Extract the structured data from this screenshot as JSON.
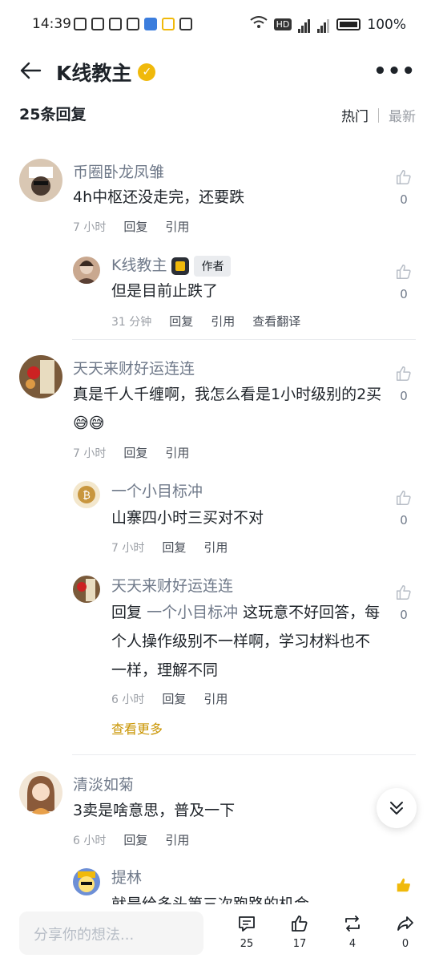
{
  "status_bar": {
    "time": "14:39",
    "battery": "100%",
    "network_badge": "HD"
  },
  "header": {
    "title": "K线教主",
    "back_icon": "back-arrow-icon",
    "more_icon": "more-dots-icon",
    "verified_icon": "verified-check-icon"
  },
  "replies": {
    "count_label": "25条回复",
    "sort_hot": "热门",
    "sort_new": "最新"
  },
  "comments": [
    {
      "name": "币圈卧龙凤雏",
      "text": "4h中枢还没走完，还要跌",
      "time": "7 小时",
      "reply": "回复",
      "quote": "引用",
      "likes": "0"
    },
    {
      "name": "K线教主",
      "badge": "作者",
      "text": "但是目前止跌了",
      "time": "31 分钟",
      "reply": "回复",
      "quote": "引用",
      "translate": "查看翻译",
      "likes": "0"
    },
    {
      "name": "天天来财好运连连",
      "text": "真是千人千缠啊，我怎么看是1小时级别的2买😅😅",
      "time": "7 小时",
      "reply": "回复",
      "quote": "引用",
      "likes": "0"
    },
    {
      "name": "一个小目标冲",
      "text": "山寨四小时三买对不对",
      "time": "7 小时",
      "reply": "回复",
      "quote": "引用",
      "likes": "0"
    },
    {
      "name": "天天来财好运连连",
      "reply_prefix": "回复",
      "mention": "一个小目标冲",
      "text": "这玩意不好回答，每个人操作级别不一样啊，学习材料也不一样，理解不同",
      "time": "6 小时",
      "reply": "回复",
      "quote": "引用",
      "likes": "0"
    },
    {
      "see_more": "查看更多"
    },
    {
      "name": "清淡如菊",
      "text": "3卖是啥意思，普及一下",
      "time": "6 小时",
      "reply": "回复",
      "quote": "引用"
    },
    {
      "name": "提林",
      "text": "就是给多头第三次跑路的机会"
    }
  ],
  "bottom_bar": {
    "placeholder": "分享你的想法...",
    "comments": "25",
    "likes": "17",
    "reposts": "4",
    "shares": "0"
  },
  "colors": {
    "accent": "#f0b90b",
    "link": "#c99400"
  }
}
